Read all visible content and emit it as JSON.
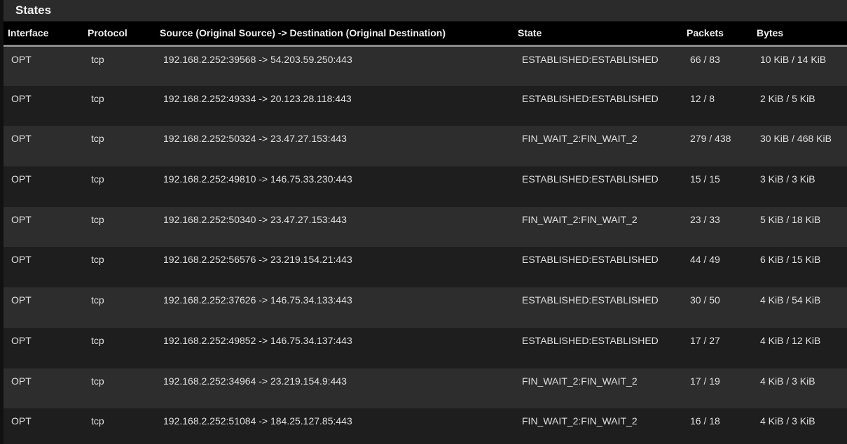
{
  "panel": {
    "title": "States"
  },
  "table": {
    "headers": {
      "interface": "Interface",
      "protocol": "Protocol",
      "source_destination": "Source (Original Source) -> Destination (Original Destination)",
      "state": "State",
      "packets": "Packets",
      "bytes": "Bytes"
    },
    "rows": [
      {
        "interface": "OPT",
        "protocol": "tcp",
        "source_destination": "192.168.2.252:39568 -> 54.203.59.250:443",
        "state": "ESTABLISHED:ESTABLISHED",
        "packets": "66 / 83",
        "bytes": "10 KiB / 14 KiB"
      },
      {
        "interface": "OPT",
        "protocol": "tcp",
        "source_destination": "192.168.2.252:49334 -> 20.123.28.118:443",
        "state": "ESTABLISHED:ESTABLISHED",
        "packets": "12 / 8",
        "bytes": "2 KiB / 5 KiB"
      },
      {
        "interface": "OPT",
        "protocol": "tcp",
        "source_destination": "192.168.2.252:50324 -> 23.47.27.153:443",
        "state": "FIN_WAIT_2:FIN_WAIT_2",
        "packets": "279 / 438",
        "bytes": "30 KiB / 468 KiB"
      },
      {
        "interface": "OPT",
        "protocol": "tcp",
        "source_destination": "192.168.2.252:49810 -> 146.75.33.230:443",
        "state": "ESTABLISHED:ESTABLISHED",
        "packets": "15 / 15",
        "bytes": "3 KiB / 3 KiB"
      },
      {
        "interface": "OPT",
        "protocol": "tcp",
        "source_destination": "192.168.2.252:50340 -> 23.47.27.153:443",
        "state": "FIN_WAIT_2:FIN_WAIT_2",
        "packets": "23 / 33",
        "bytes": "5 KiB / 18 KiB"
      },
      {
        "interface": "OPT",
        "protocol": "tcp",
        "source_destination": "192.168.2.252:56576 -> 23.219.154.21:443",
        "state": "ESTABLISHED:ESTABLISHED",
        "packets": "44 / 49",
        "bytes": "6 KiB / 15 KiB"
      },
      {
        "interface": "OPT",
        "protocol": "tcp",
        "source_destination": "192.168.2.252:37626 -> 146.75.34.133:443",
        "state": "ESTABLISHED:ESTABLISHED",
        "packets": "30 / 50",
        "bytes": "4 KiB / 54 KiB"
      },
      {
        "interface": "OPT",
        "protocol": "tcp",
        "source_destination": "192.168.2.252:49852 -> 146.75.34.137:443",
        "state": "ESTABLISHED:ESTABLISHED",
        "packets": "17 / 27",
        "bytes": "4 KiB / 12 KiB"
      },
      {
        "interface": "OPT",
        "protocol": "tcp",
        "source_destination": "192.168.2.252:34964 -> 23.219.154.9:443",
        "state": "FIN_WAIT_2:FIN_WAIT_2",
        "packets": "17 / 19",
        "bytes": "4 KiB / 3 KiB"
      },
      {
        "interface": "OPT",
        "protocol": "tcp",
        "source_destination": "192.168.2.252:51084 -> 184.25.127.85:443",
        "state": "FIN_WAIT_2:FIN_WAIT_2",
        "packets": "16 / 18",
        "bytes": "4 KiB / 3 KiB"
      }
    ]
  },
  "colors": {
    "heading_bg": "#2b2b2b",
    "header_row_bg": "#000000",
    "row_odd_bg": "#2d2d2d",
    "row_even_bg": "#1e1e1e",
    "text": "#e0e0e0"
  }
}
